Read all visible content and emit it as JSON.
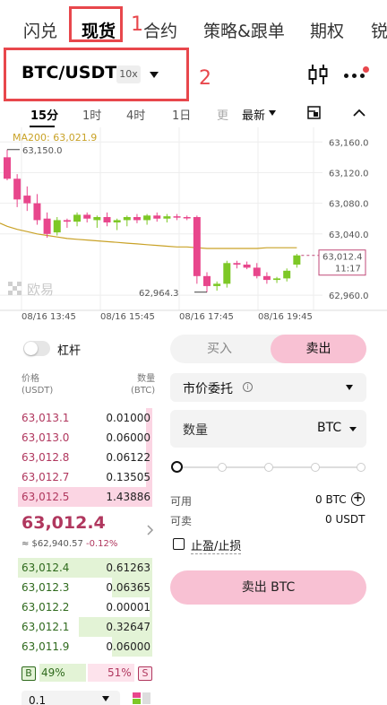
{
  "top_tabs": {
    "items": [
      {
        "label": "闪兑"
      },
      {
        "label": "现货"
      },
      {
        "label": "合约"
      },
      {
        "label": "策略&跟单"
      },
      {
        "label": "期权"
      },
      {
        "label": "锐"
      }
    ],
    "active_index": 1
  },
  "annotations": {
    "label_1": "1",
    "label_2": "2"
  },
  "pair": {
    "symbol": "BTC/USDT",
    "leverage": "10x"
  },
  "header_icons": {
    "chart_icon": "candlestick-icon",
    "more_icon": "more-dots-icon"
  },
  "timeframes": {
    "items": [
      "15分",
      "1时",
      "4时",
      "1日",
      "更",
      "最新"
    ],
    "active_index": 0
  },
  "chart_data": {
    "type": "candlestick",
    "ma_label": "MA200: 63,021.9",
    "high_marker": "63,150.0",
    "low_marker": "62,964.3",
    "current_price": "63,012.4",
    "countdown": "11:17",
    "watermark": "欧易",
    "y_ticks": [
      "63,160.0",
      "63,120.0",
      "63,080.0",
      "63,040.0",
      "62,960.0"
    ],
    "y_tick_values": [
      63160,
      63120,
      63080,
      63040,
      62960
    ],
    "x_ticks": [
      "08/16 13:45",
      "08/16 15:45",
      "08/16 17:45",
      "08/16 19:45"
    ],
    "ylim": [
      62945,
      63172
    ],
    "colors": {
      "up": "#7dc826",
      "down": "#e8468c",
      "ma": "#c9a227"
    },
    "candles": [
      {
        "o": 63140,
        "h": 63150,
        "l": 63110,
        "c": 63112
      },
      {
        "o": 63112,
        "h": 63118,
        "l": 63075,
        "c": 63085
      },
      {
        "o": 63090,
        "h": 63102,
        "l": 63070,
        "c": 63080
      },
      {
        "o": 63080,
        "h": 63092,
        "l": 63052,
        "c": 63058
      },
      {
        "o": 63060,
        "h": 63068,
        "l": 63035,
        "c": 63040
      },
      {
        "o": 63042,
        "h": 63062,
        "l": 63038,
        "c": 63058
      },
      {
        "o": 63058,
        "h": 63060,
        "l": 63048,
        "c": 63056
      },
      {
        "o": 63056,
        "h": 63068,
        "l": 63050,
        "c": 63065
      },
      {
        "o": 63065,
        "h": 63068,
        "l": 63055,
        "c": 63060
      },
      {
        "o": 63058,
        "h": 63064,
        "l": 63048,
        "c": 63062
      },
      {
        "o": 63062,
        "h": 63068,
        "l": 63050,
        "c": 63055
      },
      {
        "o": 63055,
        "h": 63060,
        "l": 63045,
        "c": 63058
      },
      {
        "o": 63058,
        "h": 63064,
        "l": 63050,
        "c": 63062
      },
      {
        "o": 63062,
        "h": 63066,
        "l": 63054,
        "c": 63058
      },
      {
        "o": 63058,
        "h": 63066,
        "l": 63052,
        "c": 63064
      },
      {
        "o": 63064,
        "h": 63068,
        "l": 63056,
        "c": 63060
      },
      {
        "o": 63060,
        "h": 63066,
        "l": 63055,
        "c": 63063
      },
      {
        "o": 63063,
        "h": 63066,
        "l": 63058,
        "c": 63062
      },
      {
        "o": 63062,
        "h": 63064,
        "l": 63058,
        "c": 63061
      },
      {
        "o": 63062,
        "h": 63064,
        "l": 62975,
        "c": 62985
      },
      {
        "o": 62985,
        "h": 62990,
        "l": 62964,
        "c": 62972
      },
      {
        "o": 62972,
        "h": 62978,
        "l": 62966,
        "c": 62975
      },
      {
        "o": 62975,
        "h": 63005,
        "l": 62970,
        "c": 63002
      },
      {
        "o": 63002,
        "h": 63005,
        "l": 62995,
        "c": 63000
      },
      {
        "o": 63000,
        "h": 63004,
        "l": 62994,
        "c": 62996
      },
      {
        "o": 62996,
        "h": 63002,
        "l": 62982,
        "c": 62985
      },
      {
        "o": 62985,
        "h": 62990,
        "l": 62975,
        "c": 62980
      },
      {
        "o": 62980,
        "h": 62984,
        "l": 62976,
        "c": 62982
      },
      {
        "o": 62982,
        "h": 62995,
        "l": 62978,
        "c": 62992
      },
      {
        "o": 63000,
        "h": 63014,
        "l": 62996,
        "c": 63012
      }
    ],
    "ma": [
      63050,
      63046,
      63043,
      63040,
      63038,
      63036,
      63034,
      63033,
      63032,
      63031,
      63030,
      63029,
      63028,
      63027,
      63026,
      63025,
      63024,
      63023,
      63023,
      63022,
      63021,
      63021,
      63021,
      63021,
      63021,
      63021,
      63022,
      63022,
      63022,
      63022
    ]
  },
  "trade": {
    "margin_label": "杠杆",
    "buy_label": "买入",
    "sell_label": "卖出",
    "order_type": "市价委托",
    "qty_label": "数量",
    "qty_unit": "BTC",
    "available_label": "可用",
    "available_value": "0 BTC",
    "sellable_label": "可卖",
    "sellable_value": "0 USDT",
    "tpsl_label": "止盈/止损",
    "submit_label": "卖出 BTC"
  },
  "orderbook": {
    "price_header": "价格",
    "price_unit": "(USDT)",
    "qty_header": "数量",
    "qty_unit": "(BTC)",
    "asks": [
      {
        "price": "63,013.1",
        "qty": "0.01000",
        "depth": 0.05
      },
      {
        "price": "63,013.0",
        "qty": "0.06000",
        "depth": 0.05
      },
      {
        "price": "63,012.8",
        "qty": "0.06122",
        "depth": 0.05
      },
      {
        "price": "63,012.7",
        "qty": "0.13505",
        "depth": 0.05
      },
      {
        "price": "63,012.5",
        "qty": "1.43886",
        "depth": 1.0
      }
    ],
    "last_price": "63,012.4",
    "last_usd": "≈ $62,940.57",
    "last_change": "-0.12%",
    "bids": [
      {
        "price": "63,012.4",
        "qty": "0.61263",
        "depth": 1.0
      },
      {
        "price": "63,012.3",
        "qty": "0.06365",
        "depth": 0.3
      },
      {
        "price": "63,012.2",
        "qty": "0.00001",
        "depth": 0.0
      },
      {
        "price": "63,012.1",
        "qty": "0.32647",
        "depth": 0.55
      },
      {
        "price": "63,011.9",
        "qty": "0.06000",
        "depth": 0.3
      }
    ],
    "buy_ratio_tag": "B",
    "buy_ratio": "49%",
    "sell_ratio": "51%",
    "sell_ratio_tag": "S",
    "depth_value": "0.1"
  }
}
